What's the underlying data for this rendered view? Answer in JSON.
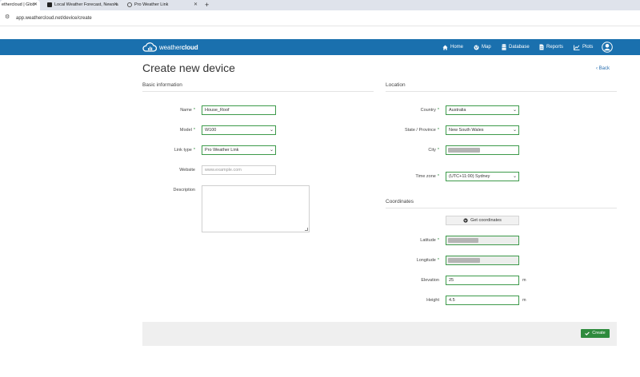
{
  "browser": {
    "tabs": [
      {
        "title": "ethercloud | Glob"
      },
      {
        "title": "Local Weather Forecast, News a"
      },
      {
        "title": "Pro Weather Link"
      }
    ],
    "new_tab": "+",
    "url": "app.weathercloud.net/device/create"
  },
  "header": {
    "logo_light": "weather",
    "logo_bold": "cloud",
    "nav": [
      {
        "label": "Home",
        "icon": "home-icon"
      },
      {
        "label": "Map",
        "icon": "globe-icon"
      },
      {
        "label": "Database",
        "icon": "database-icon"
      },
      {
        "label": "Reports",
        "icon": "document-icon"
      },
      {
        "label": "Plots",
        "icon": "chart-icon"
      }
    ]
  },
  "page": {
    "title": "Create new device",
    "back_label": "Back"
  },
  "basic": {
    "title": "Basic information",
    "name": {
      "label": "Name",
      "value": "House_Roof"
    },
    "model": {
      "label": "Model",
      "value": "W100"
    },
    "link_type": {
      "label": "Link type",
      "value": "Pro Weather Link"
    },
    "website": {
      "label": "Website",
      "placeholder": "www.example.com"
    },
    "description": {
      "label": "Description"
    }
  },
  "location": {
    "title": "Location",
    "country": {
      "label": "Country",
      "value": "Australia"
    },
    "state": {
      "label": "State / Province",
      "value": "New South Wales"
    },
    "city": {
      "label": "City"
    },
    "timezone": {
      "label": "Time zone",
      "value": "(UTC+11:00) Sydney"
    }
  },
  "coordinates": {
    "title": "Coordinates",
    "get_button": "Get coordinates",
    "latitude": {
      "label": "Latitude"
    },
    "longitude": {
      "label": "Longitude"
    },
    "elevation": {
      "label": "Elevation",
      "value": "25",
      "unit": "m"
    },
    "height": {
      "label": "Height",
      "value": "4.5",
      "unit": "m"
    }
  },
  "required_mark": "*",
  "actions": {
    "create_label": "Create"
  },
  "colors": {
    "brand": "#1a70ae",
    "accent": "#2e8b3d"
  }
}
